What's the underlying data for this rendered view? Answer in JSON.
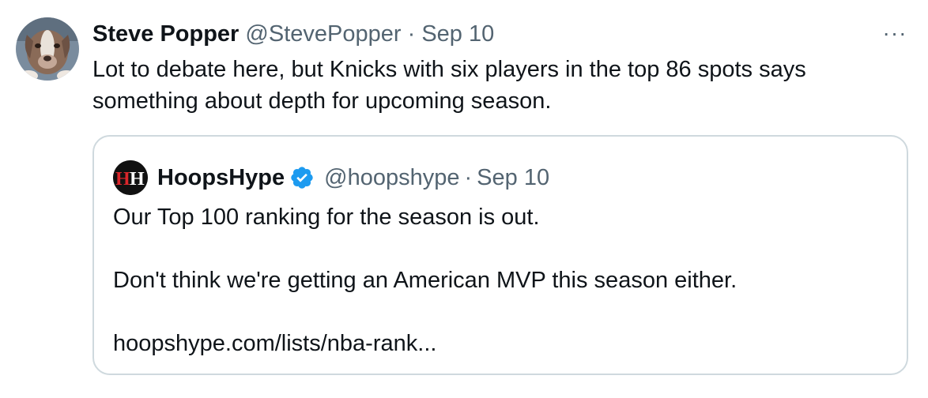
{
  "tweet": {
    "author_name": "Steve Popper",
    "author_handle": "@StevePopper",
    "separator": "·",
    "date": "Sep 10",
    "more_label": "···",
    "text": "Lot to debate here, but Knicks with six players in the top 86 spots says something about depth for upcoming season."
  },
  "quoted": {
    "logo_text": "HH",
    "author_name": "HoopsHype",
    "author_handle": "@hoopshype",
    "separator": "·",
    "date": "Sep 10",
    "line1": "Our Top 100 ranking for the season is out.",
    "line2": "Don't think we're getting an American MVP this season either.",
    "link": "hoopshype.com/lists/nba-rank..."
  },
  "colors": {
    "text": "#0f1419",
    "secondary": "#536471",
    "border": "#cfd9de",
    "verified": "#1d9bf0",
    "logo_red": "#d9262b"
  },
  "icons": {
    "avatar": "dog-avatar",
    "more": "more-dots-icon",
    "verified": "verified-badge-icon",
    "logo": "hoopshype-logo"
  }
}
